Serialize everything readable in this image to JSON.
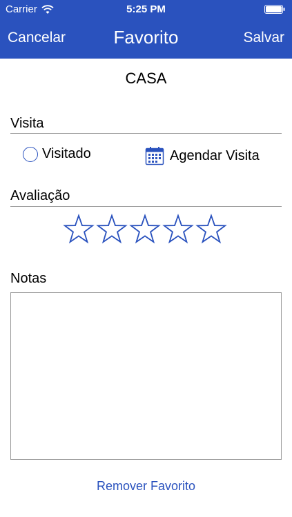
{
  "colors": {
    "accent": "#2a52be",
    "divider": "#9a9a9a",
    "text": "#000000",
    "background": "#ffffff"
  },
  "status_bar": {
    "carrier": "Carrier",
    "time": "5:25 PM",
    "icons": [
      "wifi-icon",
      "battery-icon"
    ]
  },
  "nav": {
    "cancel_label": "Cancelar",
    "title": "Favorito",
    "save_label": "Salvar"
  },
  "place": {
    "name": "CASA"
  },
  "visit": {
    "section_label": "Visita",
    "visited_label": "Visitado",
    "visited_checked": false,
    "schedule_label": "Agendar Visita",
    "schedule_icon": "calendar-icon"
  },
  "rating": {
    "section_label": "Avaliação",
    "max": 5,
    "value": 0
  },
  "notes": {
    "section_label": "Notas",
    "value": ""
  },
  "actions": {
    "remove_label": "Remover Favorito"
  }
}
